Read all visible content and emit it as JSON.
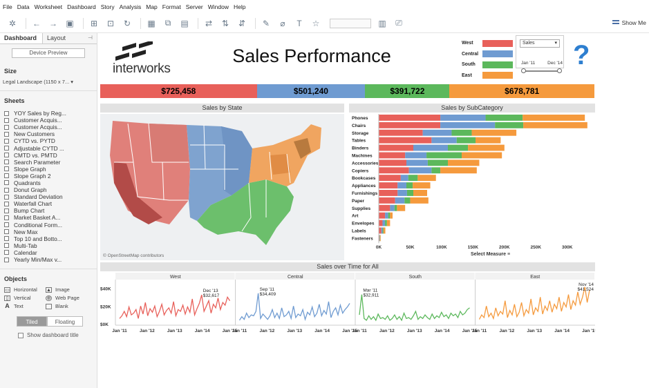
{
  "menu": [
    "File",
    "Data",
    "Worksheet",
    "Dashboard",
    "Story",
    "Analysis",
    "Map",
    "Format",
    "Server",
    "Window",
    "Help"
  ],
  "toolbar": {
    "show_me": "Show Me"
  },
  "left_panel": {
    "tabs": [
      "Dashboard",
      "Layout"
    ],
    "device_preview": "Device Preview",
    "size_label": "Size",
    "size_value": "Legal Landscape (1150 x 7...",
    "sheets_label": "Sheets",
    "sheets": [
      "YOY Sales by Reg...",
      "Customer Acquis...",
      "Customer Acquis...",
      "New Customers",
      "CYTD vs. PYTD",
      "Adjustable CYTD ...",
      "CMTD vs. PMTD",
      "Search Parameter",
      "Slope Graph",
      "Slope Graph 2",
      "Quadrants",
      "Donut Graph",
      "Standard Deviation",
      "Waterfall Chart",
      "Bump Chart",
      "Market Basket A...",
      "Conditional Form...",
      "New Max",
      "Top 10 and Botto...",
      "Multi-Tab",
      "Calendar",
      "Yearly Min/Max v..."
    ],
    "objects_label": "Objects",
    "objects": [
      "Horizontal",
      "Image",
      "Vertical",
      "Web Page",
      "Text",
      "Blank"
    ],
    "tiled": "Tiled",
    "floating": "Floating",
    "show_title": "Show dashboard title"
  },
  "dashboard": {
    "logo_text": "interworks",
    "title": "Sales Performance",
    "legend": [
      {
        "name": "West",
        "color": "#e8605a"
      },
      {
        "name": "Central",
        "color": "#6f9bd1"
      },
      {
        "name": "South",
        "color": "#5cb85c"
      },
      {
        "name": "East",
        "color": "#f59a3d"
      }
    ],
    "measure_select": "Sales",
    "date_range": {
      "start": "Jan '11",
      "end": "Dec '14"
    },
    "help_glyph": "?",
    "kpis": [
      "$725,458",
      "$501,240",
      "$391,722",
      "$678,781"
    ],
    "map_title": "Sales by State",
    "map_credit": "© OpenStreetMap contributors",
    "sub_title": "Sales by SubCategory",
    "select_measure": "Select Measure",
    "time_title": "Sales over Time for All",
    "regions": [
      "West",
      "Central",
      "South",
      "East"
    ],
    "time_annotations": [
      {
        "label": "Dec '13",
        "value": "$32,617"
      },
      {
        "label": "Sep '11",
        "value": "$34,409"
      },
      {
        "label": "Mar '11",
        "value": "$32,911"
      },
      {
        "label": "Nov '14",
        "value": "$41,524"
      }
    ]
  },
  "chart_data": [
    {
      "type": "bar",
      "title": "Sales by SubCategory",
      "stacked": true,
      "orientation": "horizontal",
      "categories": [
        "Phones",
        "Chairs",
        "Storage",
        "Tables",
        "Binders",
        "Machines",
        "Accessories",
        "Copiers",
        "Bookcases",
        "Appliances",
        "Furnishings",
        "Paper",
        "Supplies",
        "Art",
        "Envelopes",
        "Labels",
        "Fasteners"
      ],
      "series": [
        {
          "name": "West",
          "color": "#e8605a",
          "values": [
            98000,
            98000,
            70000,
            84000,
            55000,
            42000,
            44000,
            48000,
            35000,
            30000,
            30000,
            26000,
            18000,
            10000,
            6000,
            4000,
            1000
          ]
        },
        {
          "name": "Central",
          "color": "#6f9bd1",
          "values": [
            72000,
            87000,
            46000,
            40000,
            55000,
            34000,
            34000,
            36000,
            12000,
            14000,
            15000,
            15000,
            7000,
            5000,
            4000,
            2000,
            500
          ]
        },
        {
          "name": "South",
          "color": "#5cb85c",
          "values": [
            59000,
            45000,
            32000,
            30000,
            32000,
            56000,
            32000,
            14000,
            15000,
            10000,
            10000,
            9000,
            4000,
            3000,
            3000,
            1500,
            500
          ]
        },
        {
          "name": "East",
          "color": "#f59a3d",
          "values": [
            99000,
            102000,
            71000,
            40000,
            58000,
            64000,
            50000,
            58000,
            29000,
            28000,
            22000,
            29000,
            13000,
            4000,
            5000,
            3000,
            1000
          ]
        }
      ],
      "xticks": [
        "0K",
        "50K",
        "100K",
        "150K",
        "200K",
        "250K",
        "300K"
      ],
      "xlim": [
        0,
        330000
      ]
    },
    {
      "type": "line",
      "title": "Sales over Time for All",
      "panels": [
        "West",
        "Central",
        "South",
        "East"
      ],
      "xticks": [
        "Jan '11",
        "Jan '12",
        "Jan '13",
        "Jan '14",
        "Jan '15"
      ],
      "yticks": [
        "$0K",
        "$20K",
        "$40K"
      ],
      "ylim": [
        0,
        42000
      ],
      "series": [
        {
          "name": "West",
          "color": "#e8605a",
          "values": [
            6000,
            9000,
            14000,
            8000,
            19000,
            10000,
            12000,
            16000,
            6000,
            20000,
            11000,
            24000,
            9000,
            17000,
            13000,
            20000,
            8000,
            14000,
            22000,
            10000,
            15000,
            18000,
            12000,
            25000,
            9000,
            16000,
            14000,
            21000,
            11000,
            19000,
            13000,
            28000,
            10000,
            17000,
            23000,
            32617,
            14000,
            20000,
            26000,
            12000,
            22000,
            18000,
            29000,
            16000,
            24000,
            21000,
            30000,
            26000
          ]
        },
        {
          "name": "Central",
          "color": "#6f9bd1",
          "values": [
            4000,
            8000,
            5000,
            12000,
            7000,
            10000,
            9000,
            14000,
            34409,
            6000,
            11000,
            8000,
            5000,
            9000,
            16000,
            7000,
            12000,
            6000,
            18000,
            8000,
            10000,
            14000,
            6000,
            20000,
            7000,
            11000,
            9000,
            16000,
            5000,
            13000,
            10000,
            19000,
            8000,
            12000,
            22000,
            9000,
            15000,
            11000,
            25000,
            7000,
            14000,
            18000,
            10000,
            21000,
            12000,
            16000,
            19000,
            23000
          ]
        },
        {
          "name": "South",
          "color": "#5cb85c",
          "values": [
            10000,
            32911,
            6000,
            4000,
            9000,
            5000,
            8000,
            4000,
            11000,
            6000,
            7000,
            5000,
            9000,
            4000,
            6000,
            10000,
            5000,
            8000,
            4000,
            12000,
            6000,
            7000,
            5000,
            9000,
            14000,
            5000,
            8000,
            6000,
            10000,
            7000,
            5000,
            11000,
            6000,
            9000,
            7000,
            13000,
            8000,
            10000,
            6000,
            12000,
            9000,
            11000,
            7000,
            14000,
            10000,
            12000,
            16000,
            18000
          ]
        },
        {
          "name": "East",
          "color": "#f59a3d",
          "values": [
            5000,
            10000,
            7000,
            20000,
            8000,
            12000,
            6000,
            18000,
            9000,
            14000,
            11000,
            26000,
            7000,
            15000,
            10000,
            22000,
            8000,
            13000,
            24000,
            9000,
            16000,
            12000,
            28000,
            10000,
            18000,
            14000,
            30000,
            11000,
            20000,
            15000,
            26000,
            13000,
            22000,
            17000,
            30000,
            14000,
            24000,
            19000,
            33000,
            16000,
            26000,
            21000,
            36000,
            22000,
            30000,
            41524,
            24000,
            38000
          ]
        }
      ]
    }
  ]
}
